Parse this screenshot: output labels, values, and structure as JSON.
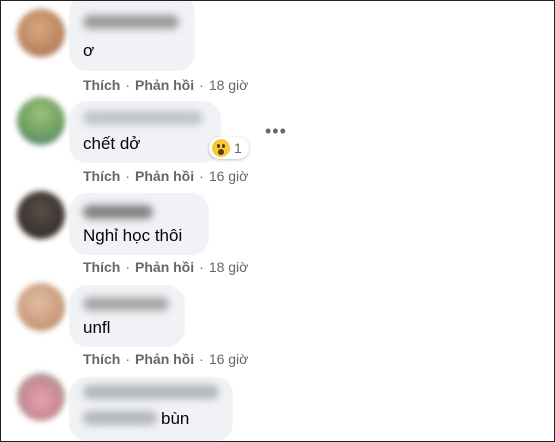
{
  "comments": [
    {
      "text": "ơ",
      "actions": {
        "like": "Thích",
        "reply": "Phản hồi",
        "time": "18 giờ"
      }
    },
    {
      "text": "chết dở",
      "reaction": {
        "icon": "wow-reaction-icon",
        "count": "1"
      },
      "more": "•••",
      "actions": {
        "like": "Thích",
        "reply": "Phản hồi",
        "time": "16 giờ"
      }
    },
    {
      "text": "Nghỉ học thôi",
      "actions": {
        "like": "Thích",
        "reply": "Phản hồi",
        "time": "18 giờ"
      }
    },
    {
      "text": "unfl",
      "actions": {
        "like": "Thích",
        "reply": "Phản hồi",
        "time": "16 giờ"
      }
    },
    {
      "text": "bùn"
    }
  ],
  "separator": "·",
  "colors": {
    "bubble": "#f0f2f5",
    "meta_text": "#65676b",
    "body_text": "#050505",
    "wow_reaction": "#f7c93c"
  }
}
